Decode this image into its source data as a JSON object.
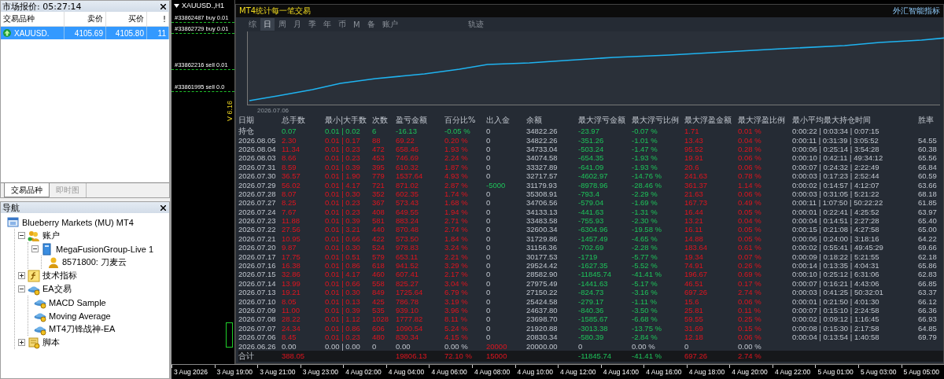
{
  "market_watch": {
    "title": "市场报价: 05:27:14",
    "columns": [
      "交易品种",
      "卖价",
      "买价",
      "!"
    ],
    "rows": [
      {
        "symbol": "XAUUSD.",
        "bid": "4105.69",
        "ask": "4105.80",
        "spread": "11",
        "kind": "up",
        "selected": true
      }
    ]
  },
  "market_tabs": [
    {
      "label": "交易品种",
      "selected": true
    },
    {
      "label": "即时图",
      "selected": false
    }
  ],
  "navigator": {
    "title": "导航",
    "tree": [
      {
        "label": "Blueberry Markets (MU) MT4",
        "kind": "broker",
        "children": [
          {
            "label": "账户",
            "kind": "accounts",
            "expanded": true,
            "children": [
              {
                "label": "MegaFusionGroup-Live 1",
                "kind": "server",
                "expanded": true,
                "children": [
                  {
                    "label": "8571800: 刀麦云",
                    "kind": "account"
                  }
                ]
              }
            ]
          },
          {
            "label": "技术指标",
            "kind": "indicators",
            "expanded": false
          },
          {
            "label": "EA交易",
            "kind": "experts",
            "expanded": true,
            "children": [
              {
                "label": "MACD Sample",
                "kind": "expert"
              },
              {
                "label": "Moving Average",
                "kind": "expert"
              },
              {
                "label": "MT4刀锋战神-EA",
                "kind": "expert"
              }
            ]
          },
          {
            "label": "脚本",
            "kind": "scripts",
            "expanded": false
          }
        ]
      }
    ]
  },
  "chart_window": {
    "title": "XAUUSD.,H1",
    "orders": [
      "#33862487 buy 0.01",
      "#33862729 buy 0.01",
      "#33862216 sell 0.01",
      "#33861995 sell 0.0"
    ],
    "version": "V 6.16"
  },
  "indicator": {
    "title": "MT4统计每一笔交易",
    "brand": "外汇智能指标",
    "periods": [
      {
        "label": "综",
        "selected": false
      },
      {
        "label": "日",
        "selected": true
      },
      {
        "label": "周",
        "selected": false
      },
      {
        "label": "月",
        "selected": false
      },
      {
        "label": "季",
        "selected": false
      },
      {
        "label": "年",
        "selected": false
      },
      {
        "label": "币",
        "selected": false
      },
      {
        "label": "M",
        "selected": false
      },
      {
        "label": "备",
        "selected": false
      },
      {
        "label": "账户",
        "selected": false
      }
    ],
    "track_button": "轨迹",
    "curve_start": "2026.07.06",
    "table": {
      "columns": [
        "日期",
        "总手数",
        "最小|大手数",
        "次数",
        "盈亏金额",
        "百分比%",
        "出入金",
        "余额",
        "最大浮亏金额",
        "最大浮亏比例",
        "最大浮盈金额",
        "最大浮盈比例",
        "最小平均最大持仓时间",
        "胜率"
      ],
      "rows": [
        {
          "date": "持仓",
          "lots": "0.07",
          "min_max": "0.01 | 0.02",
          "trades": "6",
          "pnl": "-16.13",
          "pct": "-0.05 %",
          "flow": {
            "value": "0",
            "kind": "none"
          },
          "balance": "34822.26",
          "max_dd": "-23.97",
          "max_dd_pct": "-0.07 %",
          "max_fp": "1.71",
          "max_fp_pct": "0.01 %",
          "hold_time": "0:00:22 | 0:03:34 | 0:07:15",
          "kind": "loss"
        },
        {
          "date": "2026.08.05",
          "lots": "2.30",
          "min_max": "0.01 | 0.17",
          "trades": "88",
          "pnl": "69.22",
          "pct": "0.20 %",
          "flow": {
            "value": "0",
            "kind": "none"
          },
          "balance": "34822.26",
          "max_dd": "-351.26",
          "max_dd_pct": "-1.01 %",
          "max_fp": "13.43",
          "max_fp_pct": "0.04 %",
          "hold_time": "0:00:11 | 0:31:39 | 3:05:52",
          "win_rate": "54.55",
          "kind": "profit"
        },
        {
          "date": "2026.08.04",
          "lots": "11.34",
          "min_max": "0.01 | 0.23",
          "trades": "472",
          "pnl": "658.46",
          "pct": "1.93 %",
          "flow": {
            "value": "0",
            "kind": "none"
          },
          "balance": "34733.04",
          "max_dd": "-503.24",
          "max_dd_pct": "-1.47 %",
          "max_fp": "95.52",
          "max_fp_pct": "0.28 %",
          "hold_time": "0:00:06 | 0:25:14 | 3:54:28",
          "win_rate": "60.38",
          "kind": "profit"
        },
        {
          "date": "2026.08.03",
          "lots": "8.66",
          "min_max": "0.01 | 0.23",
          "trades": "453",
          "pnl": "746.69",
          "pct": "2.24 %",
          "flow": {
            "value": "0",
            "kind": "none"
          },
          "balance": "34074.58",
          "max_dd": "-654.35",
          "max_dd_pct": "-1.93 %",
          "max_fp": "19.91",
          "max_fp_pct": "0.06 %",
          "hold_time": "0:00:10 | 0:42:11 | 49:34:12",
          "win_rate": "65.56",
          "kind": "profit"
        },
        {
          "date": "2026.07.31",
          "lots": "8.59",
          "min_max": "0.01 | 0.39",
          "trades": "395",
          "pnl": "610.32",
          "pct": "1.87 %",
          "flow": {
            "value": "0",
            "kind": "none"
          },
          "balance": "33327.89",
          "max_dd": "-641.09",
          "max_dd_pct": "-1.93 %",
          "max_fp": "20.6",
          "max_fp_pct": "0.06 %",
          "hold_time": "0:00:07 | 0:24:32 | 2:22:49",
          "win_rate": "66.84",
          "kind": "profit"
        },
        {
          "date": "2026.07.30",
          "lots": "36.57",
          "min_max": "0.01 | 1.90",
          "trades": "779",
          "pnl": "1537.64",
          "pct": "4.93 %",
          "flow": {
            "value": "0",
            "kind": "none"
          },
          "balance": "32717.57",
          "max_dd": "-4602.97",
          "max_dd_pct": "-14.76 %",
          "max_fp": "241.63",
          "max_fp_pct": "0.78 %",
          "hold_time": "0:00:03 | 0:17:23 | 2:52:44",
          "win_rate": "60.59",
          "kind": "profit"
        },
        {
          "date": "2026.07.29",
          "lots": "56.02",
          "min_max": "0.01 | 4.17",
          "trades": "721",
          "pnl": "871.02",
          "pct": "2.87 %",
          "flow": {
            "value": "-5000",
            "kind": "out"
          },
          "balance": "31179.93",
          "max_dd": "-8978.96",
          "max_dd_pct": "-28.46 %",
          "max_fp": "361.37",
          "max_fp_pct": "1.14 %",
          "hold_time": "0:00:02 | 0:14:57 | 4:12:07",
          "win_rate": "63.66",
          "kind": "profit"
        },
        {
          "date": "2026.07.28",
          "lots": "8.07",
          "min_max": "0.01 | 0.30",
          "trades": "352",
          "pnl": "602.35",
          "pct": "1.74 %",
          "flow": {
            "value": "0",
            "kind": "none"
          },
          "balance": "35308.91",
          "max_dd": "-793.4",
          "max_dd_pct": "-2.29 %",
          "max_fp": "21.63",
          "max_fp_pct": "0.06 %",
          "hold_time": "0:00:03 | 0:31:05 | 5:21:22",
          "win_rate": "68.18",
          "kind": "profit"
        },
        {
          "date": "2026.07.27",
          "lots": "8.25",
          "min_max": "0.01 | 0.23",
          "trades": "367",
          "pnl": "573.43",
          "pct": "1.68 %",
          "flow": {
            "value": "0",
            "kind": "none"
          },
          "balance": "34706.56",
          "max_dd": "-579.04",
          "max_dd_pct": "-1.69 %",
          "max_fp": "167.73",
          "max_fp_pct": "0.49 %",
          "hold_time": "0:00:11 | 1:07:50 | 50:22:22",
          "win_rate": "61.85",
          "kind": "profit"
        },
        {
          "date": "2026.07.24",
          "lots": "7.67",
          "min_max": "0.01 | 0.23",
          "trades": "408",
          "pnl": "649.55",
          "pct": "1.94 %",
          "flow": {
            "value": "0",
            "kind": "none"
          },
          "balance": "34133.13",
          "max_dd": "-441.63",
          "max_dd_pct": "-1.31 %",
          "max_fp": "16.44",
          "max_fp_pct": "0.05 %",
          "hold_time": "0:00:01 | 0:22:41 | 4:25:52",
          "win_rate": "63.97",
          "kind": "profit"
        },
        {
          "date": "2026.07.23",
          "lots": "11.88",
          "min_max": "0.01 | 0.39",
          "trades": "581",
          "pnl": "883.24",
          "pct": "2.71 %",
          "flow": {
            "value": "0",
            "kind": "none"
          },
          "balance": "33483.58",
          "max_dd": "-755.93",
          "max_dd_pct": "-2.30 %",
          "max_fp": "13.21",
          "max_fp_pct": "0.04 %",
          "hold_time": "0:00:04 | 0:14:51 | 2:27:28",
          "win_rate": "65.40",
          "kind": "profit"
        },
        {
          "date": "2026.07.22",
          "lots": "27.56",
          "min_max": "0.01 | 3.21",
          "trades": "440",
          "pnl": "870.48",
          "pct": "2.74 %",
          "flow": {
            "value": "0",
            "kind": "none"
          },
          "balance": "32600.34",
          "max_dd": "-6304.96",
          "max_dd_pct": "-19.58 %",
          "max_fp": "16.11",
          "max_fp_pct": "0.05 %",
          "hold_time": "0:00:15 | 0:21:08 | 4:27:58",
          "win_rate": "65.00",
          "kind": "profit"
        },
        {
          "date": "2026.07.21",
          "lots": "10.95",
          "min_max": "0.01 | 0.66",
          "trades": "422",
          "pnl": "573.50",
          "pct": "1.84 %",
          "flow": {
            "value": "0",
            "kind": "none"
          },
          "balance": "31729.86",
          "max_dd": "-1457.49",
          "max_dd_pct": "-4.65 %",
          "max_fp": "14.88",
          "max_fp_pct": "0.05 %",
          "hold_time": "0:00:06 | 0:24:00 | 3:18:16",
          "win_rate": "64.22",
          "kind": "profit"
        },
        {
          "date": "2026.07.20",
          "lots": "9.87",
          "min_max": "0.01 | 0.30",
          "trades": "524",
          "pnl": "978.83",
          "pct": "3.24 %",
          "flow": {
            "value": "0",
            "kind": "none"
          },
          "balance": "31156.36",
          "max_dd": "-702.69",
          "max_dd_pct": "-2.28 %",
          "max_fp": "183.64",
          "max_fp_pct": "0.61 %",
          "hold_time": "0:00:02 | 0:55:41 | 49:45:29",
          "win_rate": "69.66",
          "kind": "profit"
        },
        {
          "date": "2026.07.17",
          "lots": "17.75",
          "min_max": "0.01 | 0.51",
          "trades": "579",
          "pnl": "653.11",
          "pct": "2.21 %",
          "flow": {
            "value": "0",
            "kind": "none"
          },
          "balance": "30177.53",
          "max_dd": "-1719",
          "max_dd_pct": "-5.77 %",
          "max_fp": "19.34",
          "max_fp_pct": "0.07 %",
          "hold_time": "0:00:09 | 0:18:22 | 5:21:55",
          "win_rate": "62.18",
          "kind": "profit"
        },
        {
          "date": "2026.07.16",
          "lots": "16.38",
          "min_max": "0.01 | 0.86",
          "trades": "618",
          "pnl": "941.52",
          "pct": "3.29 %",
          "flow": {
            "value": "0",
            "kind": "none"
          },
          "balance": "29524.42",
          "max_dd": "-1627.35",
          "max_dd_pct": "-5.52 %",
          "max_fp": "74.91",
          "max_fp_pct": "0.26 %",
          "hold_time": "0:00:14 | 0:13:35 | 4:04:31",
          "win_rate": "65.86",
          "kind": "profit"
        },
        {
          "date": "2026.07.15",
          "lots": "32.86",
          "min_max": "0.01 | 4.17",
          "trades": "460",
          "pnl": "607.41",
          "pct": "2.17 %",
          "flow": {
            "value": "0",
            "kind": "none"
          },
          "balance": "28582.90",
          "max_dd": "-11845.74",
          "max_dd_pct": "-41.41 %",
          "max_fp": "196.67",
          "max_fp_pct": "0.69 %",
          "hold_time": "0:00:10 | 0:25:12 | 6:31:06",
          "win_rate": "62.83",
          "kind": "profit"
        },
        {
          "date": "2026.07.14",
          "lots": "13.99",
          "min_max": "0.01 | 0.66",
          "trades": "558",
          "pnl": "825.27",
          "pct": "3.04 %",
          "flow": {
            "value": "0",
            "kind": "none"
          },
          "balance": "27975.49",
          "max_dd": "-1441.63",
          "max_dd_pct": "-5.17 %",
          "max_fp": "46.51",
          "max_fp_pct": "0.17 %",
          "hold_time": "0:00:07 | 0:16:21 | 4:43:06",
          "win_rate": "66.85",
          "kind": "profit"
        },
        {
          "date": "2026.07.13",
          "lots": "19.21",
          "min_max": "0.01 | 0.30",
          "trades": "849",
          "pnl": "1725.64",
          "pct": "6.79 %",
          "flow": {
            "value": "0",
            "kind": "none"
          },
          "balance": "27150.22",
          "max_dd": "-824.73",
          "max_dd_pct": "-3.16 %",
          "max_fp": "697.26",
          "max_fp_pct": "2.74 %",
          "hold_time": "0:00:03 | 0:41:25 | 50:32:01",
          "win_rate": "63.37",
          "kind": "profit"
        },
        {
          "date": "2026.07.10",
          "lots": "8.05",
          "min_max": "0.01 | 0.13",
          "trades": "425",
          "pnl": "786.78",
          "pct": "3.19 %",
          "flow": {
            "value": "0",
            "kind": "none"
          },
          "balance": "25424.58",
          "max_dd": "-279.17",
          "max_dd_pct": "-1.11 %",
          "max_fp": "15.6",
          "max_fp_pct": "0.06 %",
          "hold_time": "0:00:01 | 0:21:50 | 4:01:30",
          "win_rate": "66.12",
          "kind": "profit"
        },
        {
          "date": "2026.07.09",
          "lots": "11.00",
          "min_max": "0.01 | 0.39",
          "trades": "535",
          "pnl": "939.10",
          "pct": "3.96 %",
          "flow": {
            "value": "0",
            "kind": "none"
          },
          "balance": "24637.80",
          "max_dd": "-840.36",
          "max_dd_pct": "-3.50 %",
          "max_fp": "25.81",
          "max_fp_pct": "0.11 %",
          "hold_time": "0:00:07 | 0:15:10 | 2:24:58",
          "win_rate": "66.36",
          "kind": "profit"
        },
        {
          "date": "2026.07.08",
          "lots": "28.22",
          "min_max": "0.01 | 1.12",
          "trades": "1028",
          "pnl": "1777.82",
          "pct": "8.11 %",
          "flow": {
            "value": "0",
            "kind": "none"
          },
          "balance": "23698.70",
          "max_dd": "-1585.67",
          "max_dd_pct": "-6.68 %",
          "max_fp": "59.55",
          "max_fp_pct": "0.25 %",
          "hold_time": "0:00:02 | 0:09:12 | 1:16:45",
          "win_rate": "66.93",
          "kind": "profit"
        },
        {
          "date": "2026.07.07",
          "lots": "24.34",
          "min_max": "0.01 | 0.86",
          "trades": "606",
          "pnl": "1090.54",
          "pct": "5.24 %",
          "flow": {
            "value": "0",
            "kind": "none"
          },
          "balance": "21920.88",
          "max_dd": "-3013.38",
          "max_dd_pct": "-13.75 %",
          "max_fp": "31.69",
          "max_fp_pct": "0.15 %",
          "hold_time": "0:00:08 | 0:15:30 | 2:17:58",
          "win_rate": "64.85",
          "kind": "profit"
        },
        {
          "date": "2026.07.06",
          "lots": "8.45",
          "min_max": "0.01 | 0.23",
          "trades": "480",
          "pnl": "830.34",
          "pct": "4.15 %",
          "flow": {
            "value": "0",
            "kind": "none"
          },
          "balance": "20830.34",
          "max_dd": "-580.39",
          "max_dd_pct": "-2.84 %",
          "max_fp": "12.18",
          "max_fp_pct": "0.06 %",
          "hold_time": "0:00:04 | 0:13:54 | 1:40:58",
          "win_rate": "69.79",
          "kind": "profit"
        },
        {
          "date": "2026.06.26",
          "lots": "0.00",
          "min_max": "0.00 | 0.00",
          "trades": "0",
          "pnl": "0.00",
          "pct": "0.00 %",
          "flow": {
            "value": "20000",
            "kind": "in"
          },
          "balance": "20000.00",
          "max_dd": "0",
          "max_dd_pct": "0.00 %",
          "max_fp": "0",
          "max_fp_pct": "0.00 %",
          "kind": "flat"
        }
      ],
      "totals": {
        "date": "合计",
        "lots": "388.05",
        "pnl": "19806.13",
        "pct": "72.10 %",
        "flow": {
          "value": "15000",
          "kind": "in"
        },
        "max_dd": "-11845.74",
        "max_dd_pct": "-41.41 %",
        "max_fp": "697.26",
        "max_fp_pct": "2.74 %",
        "kind": "profit"
      }
    }
  },
  "time_axis": [
    "3 Aug 2026",
    "3 Aug 19:00",
    "3 Aug 21:00",
    "3 Aug 23:00",
    "4 Aug 02:00",
    "4 Aug 04:00",
    "4 Aug 06:00",
    "4 Aug 08:00",
    "4 Aug 10:00",
    "4 Aug 12:00",
    "4 Aug 14:00",
    "4 Aug 16:00",
    "4 Aug 18:00",
    "4 Aug 20:00",
    "4 Aug 22:00",
    "5 Aug 01:00",
    "5 Aug 03:00",
    "5 Aug 05:00"
  ]
}
